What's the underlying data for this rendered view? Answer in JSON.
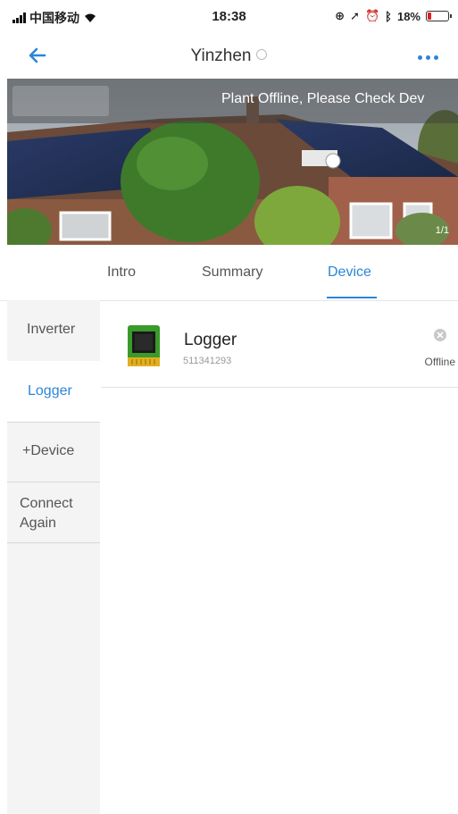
{
  "status_bar": {
    "carrier": "中国移动",
    "time": "18:38",
    "battery": "18%",
    "battery_level": 0.18,
    "battery_color": "#e02020"
  },
  "nav": {
    "title": "Yinzhen",
    "back_icon": "arrow-left-icon",
    "more_icon": "more-dots-icon",
    "accent": "#2b86d9"
  },
  "banner": {
    "message": "Plant Offline, Please Check Dev",
    "page": "1/1"
  },
  "tabs": [
    {
      "label": "Intro",
      "active": false
    },
    {
      "label": "Summary",
      "active": false
    },
    {
      "label": "Device",
      "active": true
    }
  ],
  "sidebar": {
    "items": [
      {
        "label": "Inverter",
        "active": false
      },
      {
        "label": "Logger",
        "active": true
      },
      {
        "label": "+Device",
        "active": false
      },
      {
        "label": "Connect\nAgain",
        "active": false
      }
    ]
  },
  "devices": [
    {
      "name": "Logger",
      "serial": "511341293",
      "status": "Offline",
      "icon": "logger-chip-icon",
      "status_icon": "close-circle-icon"
    }
  ]
}
